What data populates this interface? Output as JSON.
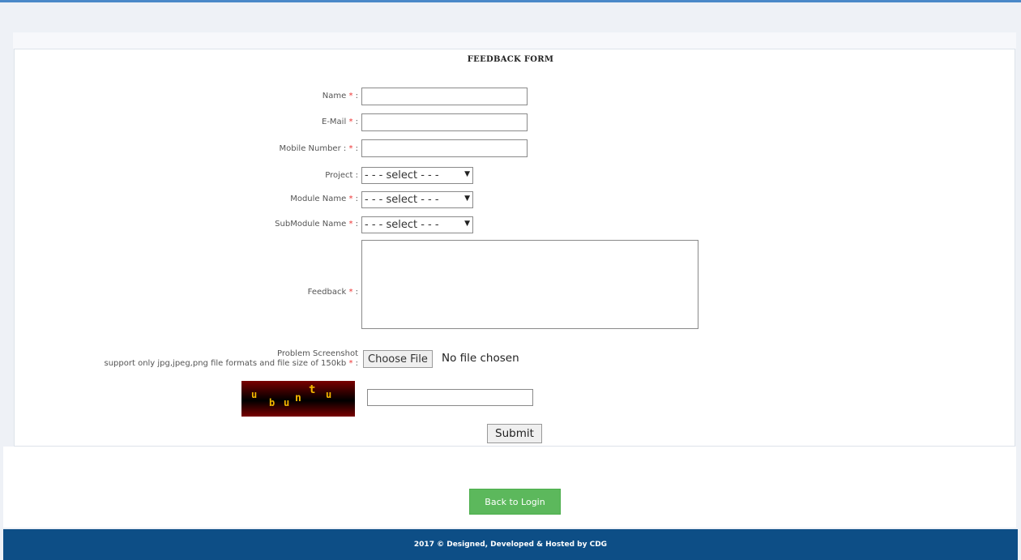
{
  "form": {
    "title": "FEEDBACK FORM",
    "required_mark": "*",
    "name_label": "Name",
    "email_label": "E-Mail",
    "mobile_label": "Mobile Number :",
    "project_label": "Project :",
    "module_label": "Module Name",
    "submodule_label": "SubModule Name",
    "feedback_label": "Feedback",
    "screenshot_label": "Problem Screenshot",
    "screenshot_hint": "support only jpg,jpeg,png file formats and file size of 150kb",
    "select_placeholder": "- - - select - - -",
    "choose_file_label": "Choose File",
    "no_file_text": "No file chosen",
    "captcha_text": "ubuntu",
    "captcha_chars": [
      "u",
      "b",
      "u",
      "n",
      "t",
      "u"
    ],
    "submit_label": "Submit"
  },
  "back_label": "Back to Login",
  "footer": {
    "text": "2017 © Designed, Developed & Hosted by CDG"
  },
  "colors": {
    "accent": "#4a88c8",
    "footer_bg": "#0d4e86",
    "back_button": "#5cb85c",
    "required": "#ee3333"
  }
}
